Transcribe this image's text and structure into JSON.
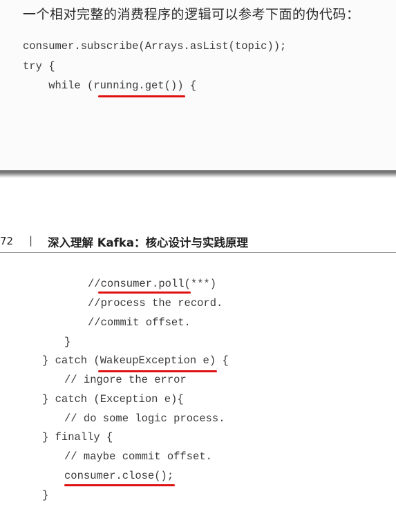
{
  "top_page": {
    "intro_text": "一个相对完整的消费程序的逻辑可以参考下面的伪代码：",
    "code_lines": [
      "consumer.subscribe(Arrays.asList(topic));",
      "try {",
      "    while (running.get()) {"
    ]
  },
  "bottom_page": {
    "page_number": "72",
    "separator": "|",
    "book_title": "深入理解 Kafka：核心设计与实践原理",
    "code_lines": [
      "//consumer.poll(***)",
      "//process the record.",
      "//commit offset.",
      "}",
      "} catch (WakeupException e) {",
      "// ingore the error",
      "} catch (Exception e){",
      "// do some logic process.",
      "} finally {",
      "// maybe commit offset.",
      "consumer.close();",
      "}"
    ]
  },
  "colors": {
    "underline": "#e01010",
    "divider": "#7a7a7a"
  }
}
